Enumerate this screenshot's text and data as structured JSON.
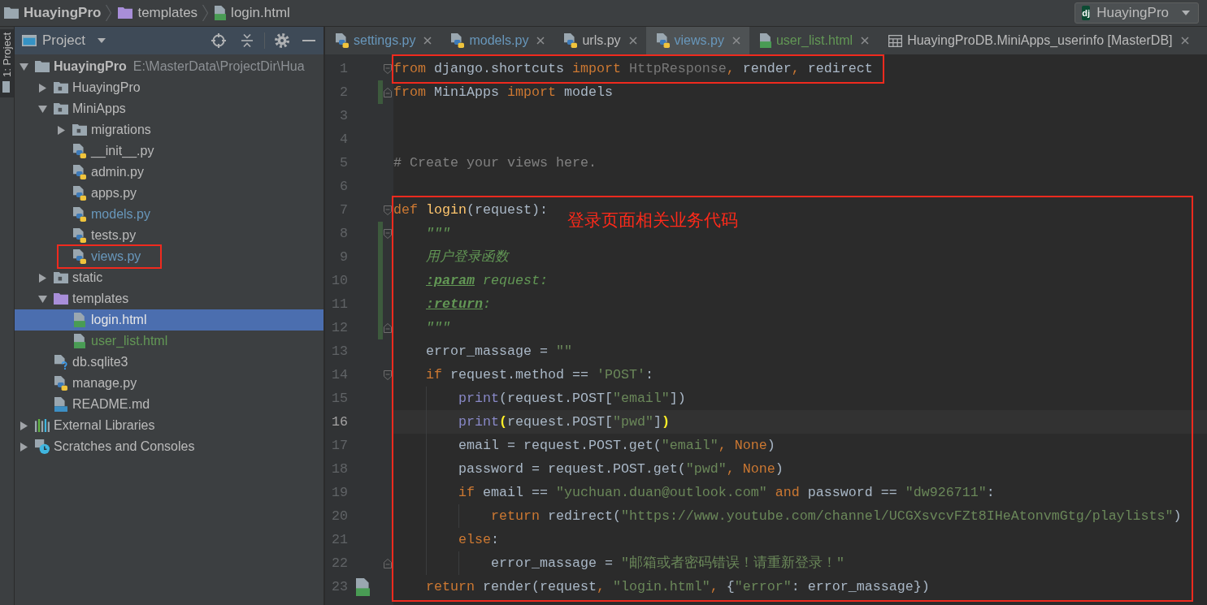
{
  "navigation_bar": {
    "breadcrumbs": [
      {
        "label": "HuayingPro",
        "kind": "project"
      },
      {
        "label": "templates",
        "kind": "template-folder"
      },
      {
        "label": "login.html",
        "kind": "html-file"
      }
    ],
    "run_config": {
      "badge": "dj",
      "label": "HuayingPro"
    }
  },
  "tool_stripe": [
    {
      "label": "1: Project",
      "selected": true
    }
  ],
  "project_panel": {
    "title": "Project",
    "tree": [
      {
        "label": "HuayingPro",
        "kind": "project",
        "path": "E:\\MasterData\\ProjectDir\\Hua",
        "expanded": true,
        "selected": false,
        "children": [
          {
            "label": "HuayingPro",
            "kind": "package",
            "expanded": false,
            "selected": false
          },
          {
            "label": "MiniApps",
            "kind": "package",
            "expanded": true,
            "selected": false,
            "children": [
              {
                "label": "migrations",
                "kind": "package",
                "expanded": false,
                "selected": false
              },
              {
                "label": "__init__.py",
                "kind": "python-file",
                "modified": false,
                "added": false,
                "selected": false
              },
              {
                "label": "admin.py",
                "kind": "python-file",
                "modified": false,
                "added": false,
                "selected": false
              },
              {
                "label": "apps.py",
                "kind": "python-file",
                "modified": false,
                "added": false,
                "selected": false
              },
              {
                "label": "models.py",
                "kind": "python-file",
                "modified": true,
                "added": false,
                "selected": false
              },
              {
                "label": "tests.py",
                "kind": "python-file",
                "modified": false,
                "added": false,
                "selected": false
              },
              {
                "label": "views.py",
                "kind": "python-file",
                "modified": true,
                "added": false,
                "selected": false,
                "boxed": true
              }
            ]
          },
          {
            "label": "static",
            "kind": "package",
            "expanded": false,
            "selected": false
          },
          {
            "label": "templates",
            "kind": "template-folder",
            "expanded": true,
            "selected": false,
            "children": [
              {
                "label": "login.html",
                "kind": "html-file",
                "modified": false,
                "added": false,
                "selected": true
              },
              {
                "label": "user_list.html",
                "kind": "html-file",
                "modified": false,
                "added": true,
                "selected": false
              }
            ]
          },
          {
            "label": "db.sqlite3",
            "kind": "unknown-file",
            "modified": false,
            "added": false,
            "selected": false
          },
          {
            "label": "manage.py",
            "kind": "python-file",
            "modified": false,
            "added": false,
            "selected": false
          },
          {
            "label": "README.md",
            "kind": "markdown-file",
            "modified": false,
            "added": false,
            "selected": false
          }
        ]
      },
      {
        "label": "External Libraries",
        "kind": "libraries",
        "expanded": false,
        "selected": false
      },
      {
        "label": "Scratches and Consoles",
        "kind": "scratches",
        "expanded": false,
        "selected": false
      }
    ]
  },
  "editor": {
    "tabs": [
      {
        "label": "settings.py",
        "kind": "python-file",
        "modified": true,
        "added": false,
        "selected": false
      },
      {
        "label": "models.py",
        "kind": "python-file",
        "modified": true,
        "added": false,
        "selected": false
      },
      {
        "label": "urls.py",
        "kind": "python-file",
        "modified": false,
        "added": false,
        "selected": false
      },
      {
        "label": "views.py",
        "kind": "python-file",
        "modified": true,
        "added": false,
        "selected": true
      },
      {
        "label": "user_list.html",
        "kind": "html-file",
        "modified": false,
        "added": true,
        "selected": false
      },
      {
        "label": "HuayingProDB.MiniApps_userinfo [MasterDB]",
        "kind": "table",
        "modified": false,
        "added": false,
        "selected": false
      }
    ],
    "code_groups": [
      {
        "boxed": true,
        "lines": [
          {
            "number": "1",
            "changed": false,
            "current": false,
            "fold_start": true,
            "tokens": [
              {
                "kind": "keyword",
                "text": "from"
              },
              {
                "kind": "plain",
                "text": " django.shortcuts "
              },
              {
                "kind": "keyword",
                "text": "import"
              },
              {
                "kind": "unused",
                "text": " HttpResponse"
              },
              {
                "kind": "keyword",
                "text": ","
              },
              {
                "kind": "plain",
                "text": " render"
              },
              {
                "kind": "keyword",
                "text": ","
              },
              {
                "kind": "plain",
                "text": " redirect"
              }
            ]
          }
        ]
      },
      {
        "lines": [
          {
            "number": "2",
            "changed": true,
            "current": false,
            "fold_end": true,
            "tokens": [
              {
                "kind": "keyword",
                "text": "from"
              },
              {
                "kind": "plain",
                "text": " MiniApps "
              },
              {
                "kind": "keyword",
                "text": "import"
              },
              {
                "kind": "plain",
                "text": " models"
              }
            ]
          },
          {
            "number": "3",
            "changed": false,
            "current": false
          },
          {
            "number": "4",
            "changed": false,
            "current": false
          },
          {
            "number": "5",
            "changed": false,
            "current": false,
            "tokens": [
              {
                "kind": "comment",
                "text": "# Create your views here."
              }
            ]
          },
          {
            "number": "6",
            "changed": false,
            "current": false
          }
        ]
      },
      {
        "boxed": true,
        "label": "登录页面相关业务代码",
        "lines": [
          {
            "number": "7",
            "changed": false,
            "current": false,
            "fold_start": true,
            "tokens": [
              {
                "kind": "keyword",
                "text": "def"
              },
              {
                "kind": "function",
                "text": " login"
              },
              {
                "kind": "plain",
                "text": "(request):"
              }
            ]
          },
          {
            "number": "8",
            "changed": true,
            "current": false,
            "fold_start": true,
            "tokens": [
              {
                "kind": "docstring",
                "text": "    \"\"\""
              }
            ]
          },
          {
            "number": "9",
            "changed": true,
            "current": false,
            "tokens": [
              {
                "kind": "docstring",
                "text": "    用户登录函数"
              }
            ]
          },
          {
            "number": "10",
            "changed": true,
            "current": false,
            "tokens": [
              {
                "kind": "doctag",
                "text": "    :param"
              },
              {
                "kind": "docstring",
                "text": " request:"
              }
            ]
          },
          {
            "number": "11",
            "changed": true,
            "current": false,
            "tokens": [
              {
                "kind": "doctag",
                "text": "    :return"
              },
              {
                "kind": "docstring",
                "text": ":"
              }
            ]
          },
          {
            "number": "12",
            "changed": true,
            "current": false,
            "fold_end": true,
            "tokens": [
              {
                "kind": "docstring",
                "text": "    \"\"\""
              }
            ]
          },
          {
            "number": "13",
            "changed": false,
            "current": false,
            "tokens": [
              {
                "kind": "plain",
                "text": "    error_massage = "
              },
              {
                "kind": "string",
                "text": "\"\""
              }
            ]
          },
          {
            "number": "14",
            "changed": false,
            "current": false,
            "fold_start": true,
            "tokens": [
              {
                "kind": "keyword",
                "text": "    if"
              },
              {
                "kind": "plain",
                "text": " request.method == "
              },
              {
                "kind": "string",
                "text": "'POST'"
              },
              {
                "kind": "plain",
                "text": ":"
              }
            ]
          },
          {
            "number": "15",
            "changed": false,
            "current": false,
            "tokens": [
              {
                "kind": "builtin",
                "text": "        print"
              },
              {
                "kind": "plain",
                "text": "(request.POST["
              },
              {
                "kind": "string",
                "text": "\"email\""
              },
              {
                "kind": "plain",
                "text": "])"
              }
            ]
          },
          {
            "number": "16",
            "changed": false,
            "current": true,
            "tokens": [
              {
                "kind": "builtin",
                "text": "        print"
              },
              {
                "kind": "brace",
                "text": "("
              },
              {
                "kind": "plain",
                "text": "request.POST["
              },
              {
                "kind": "string",
                "text": "\"pwd\""
              },
              {
                "kind": "plain",
                "text": "]"
              },
              {
                "kind": "brace",
                "text": ")"
              }
            ]
          },
          {
            "number": "17",
            "changed": false,
            "current": false,
            "tokens": [
              {
                "kind": "plain",
                "text": "        email = request.POST.get("
              },
              {
                "kind": "string",
                "text": "\"email\""
              },
              {
                "kind": "keyword",
                "text": ", None"
              },
              {
                "kind": "plain",
                "text": ")"
              }
            ]
          },
          {
            "number": "18",
            "changed": false,
            "current": false,
            "tokens": [
              {
                "kind": "plain",
                "text": "        password = request.POST.get("
              },
              {
                "kind": "string",
                "text": "\"pwd\""
              },
              {
                "kind": "keyword",
                "text": ", None"
              },
              {
                "kind": "plain",
                "text": ")"
              }
            ]
          },
          {
            "number": "19",
            "changed": false,
            "current": false,
            "tokens": [
              {
                "kind": "keyword",
                "text": "        if"
              },
              {
                "kind": "plain",
                "text": " email == "
              },
              {
                "kind": "string",
                "text": "\"yuchuan.duan@outlook.com\""
              },
              {
                "kind": "keyword",
                "text": " and"
              },
              {
                "kind": "plain",
                "text": " password == "
              },
              {
                "kind": "string",
                "text": "\"dw926711\""
              },
              {
                "kind": "plain",
                "text": ":"
              }
            ]
          },
          {
            "number": "20",
            "changed": false,
            "current": false,
            "tokens": [
              {
                "kind": "keyword",
                "text": "            return"
              },
              {
                "kind": "plain",
                "text": " redirect("
              },
              {
                "kind": "string",
                "text": "\"https://www.youtube.com/channel/UCGXsvcvFZt8IHeAtonvmGtg/playlists\""
              },
              {
                "kind": "plain",
                "text": ")"
              }
            ]
          },
          {
            "number": "21",
            "changed": false,
            "current": false,
            "tokens": [
              {
                "kind": "keyword",
                "text": "        else"
              },
              {
                "kind": "plain",
                "text": ":"
              }
            ]
          },
          {
            "number": "22",
            "changed": false,
            "current": false,
            "fold_end": true,
            "tokens": [
              {
                "kind": "plain",
                "text": "            error_massage = "
              },
              {
                "kind": "string",
                "text": "\"邮箱或者密码错误！请重新登录！\""
              }
            ]
          },
          {
            "number": "23",
            "changed": false,
            "current": false,
            "template_link": true,
            "tokens": [
              {
                "kind": "keyword",
                "text": "    return"
              },
              {
                "kind": "plain",
                "text": " render(request"
              },
              {
                "kind": "keyword",
                "text": ","
              },
              {
                "kind": "string",
                "text": " \"login.html\""
              },
              {
                "kind": "keyword",
                "text": ","
              },
              {
                "kind": "plain",
                "text": " {"
              },
              {
                "kind": "string",
                "text": "\"error\""
              },
              {
                "kind": "plain",
                "text": ": error_massage})"
              }
            ]
          }
        ]
      }
    ]
  }
}
